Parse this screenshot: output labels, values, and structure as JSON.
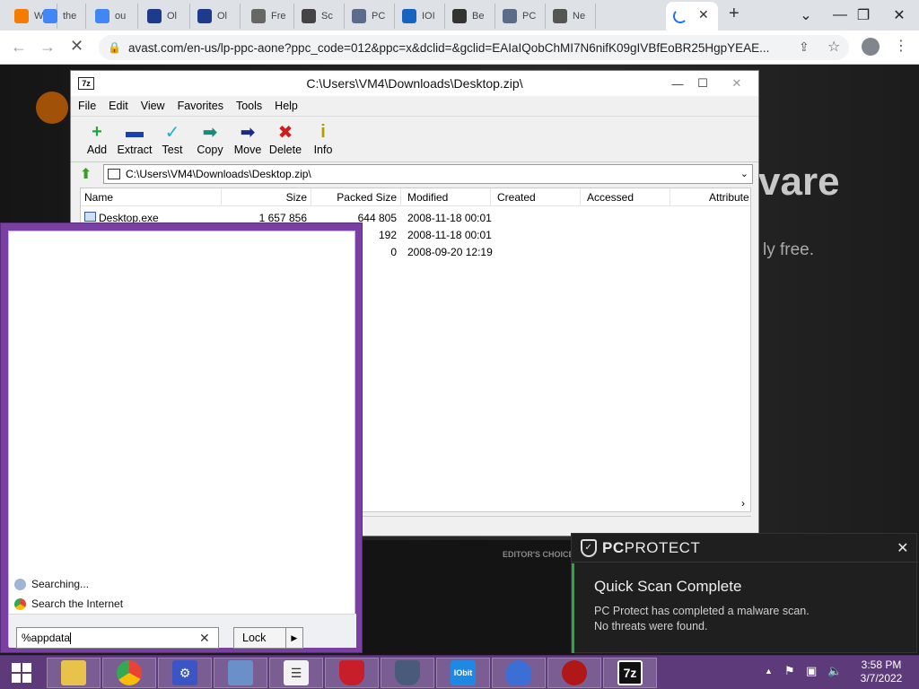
{
  "browser": {
    "tabs": [
      {
        "label": "Wi",
        "icon": "blogger-icon",
        "color": "#f57c00"
      },
      {
        "label": "the",
        "icon": "google-icon",
        "color": "#4285f4"
      },
      {
        "label": "ou",
        "icon": "google-icon",
        "color": "#4285f4"
      },
      {
        "label": "Ol",
        "icon": "ov-icon",
        "color": "#1e3a8a"
      },
      {
        "label": "Ol",
        "icon": "ov-icon",
        "color": "#1e3a8a"
      },
      {
        "label": "Fre",
        "icon": "chat-icon",
        "color": "#666666"
      },
      {
        "label": "Sc",
        "icon": "timer-icon",
        "color": "#444444"
      },
      {
        "label": "PC",
        "icon": "shield-icon",
        "color": "#5a6c8a"
      },
      {
        "label": "IOI",
        "icon": "iobit-icon",
        "color": "#1565c0"
      },
      {
        "label": "Be",
        "icon": "b-shield-icon",
        "color": "#333333"
      },
      {
        "label": "PC",
        "icon": "shield-icon",
        "color": "#5a6c8a"
      },
      {
        "label": "Ne",
        "icon": "chrome-icon",
        "color": "#555555"
      }
    ],
    "url": "avast.com/en-us/lp-ppc-aone?ppc_code=012&ppc=x&dclid=&gclid=EAIaIQobChMI7N6nifK09gIVBfEoBR25HgpYEAE..."
  },
  "webpage": {
    "hero_title": "vare",
    "hero_sub": "ly free.",
    "editors_choice": "EDITOR'S CHOICE"
  },
  "zip": {
    "title": "C:\\Users\\VM4\\Downloads\\Desktop.zip\\",
    "menu": [
      "File",
      "Edit",
      "View",
      "Favorites",
      "Tools",
      "Help"
    ],
    "tools": [
      {
        "label": "Add",
        "glyph": "+",
        "color": "#22a63a",
        "icon": "add-icon"
      },
      {
        "label": "Extract",
        "glyph": "▬",
        "color": "#1a3fb0",
        "icon": "extract-icon"
      },
      {
        "label": "Test",
        "glyph": "✓",
        "color": "#19b3c6",
        "icon": "test-icon"
      },
      {
        "label": "Copy",
        "glyph": "➡",
        "color": "#1a8a7a",
        "icon": "copy-icon"
      },
      {
        "label": "Move",
        "glyph": "➡",
        "color": "#1a2a8a",
        "icon": "move-icon"
      },
      {
        "label": "Delete",
        "glyph": "✖",
        "color": "#d01c1c",
        "icon": "delete-icon"
      },
      {
        "label": "Info",
        "glyph": "i",
        "color": "#b59a00",
        "icon": "info-icon"
      }
    ],
    "address": "C:\\Users\\VM4\\Downloads\\Desktop.zip\\",
    "columns": [
      "Name",
      "Size",
      "Packed Size",
      "Modified",
      "Created",
      "Accessed",
      "Attribute"
    ],
    "rows": [
      {
        "name": "Desktop.exe",
        "size": "1 657 856",
        "packed": "644 805",
        "modified": "2008-11-18 00:01"
      },
      {
        "name": "",
        "size": "",
        "packed": "192",
        "modified": "2008-11-18 00:01"
      },
      {
        "name": "",
        "size": "",
        "packed": "0",
        "modified": "2008-09-20 12:19"
      }
    ]
  },
  "search": {
    "results": [
      "Searching...",
      "Search the Internet"
    ],
    "query": "%appdata",
    "lock_label": "Lock"
  },
  "toast": {
    "brand_pc": "PC",
    "brand_rest": "PROTECT",
    "heading": "Quick Scan Complete",
    "line1": "PC Protect has completed a malware scan.",
    "line2": "No threats were found."
  },
  "taskbar": {
    "time": "3:58 PM",
    "date": "3/7/2022",
    "zip_label": "7z",
    "iobit_label": "IObit"
  }
}
